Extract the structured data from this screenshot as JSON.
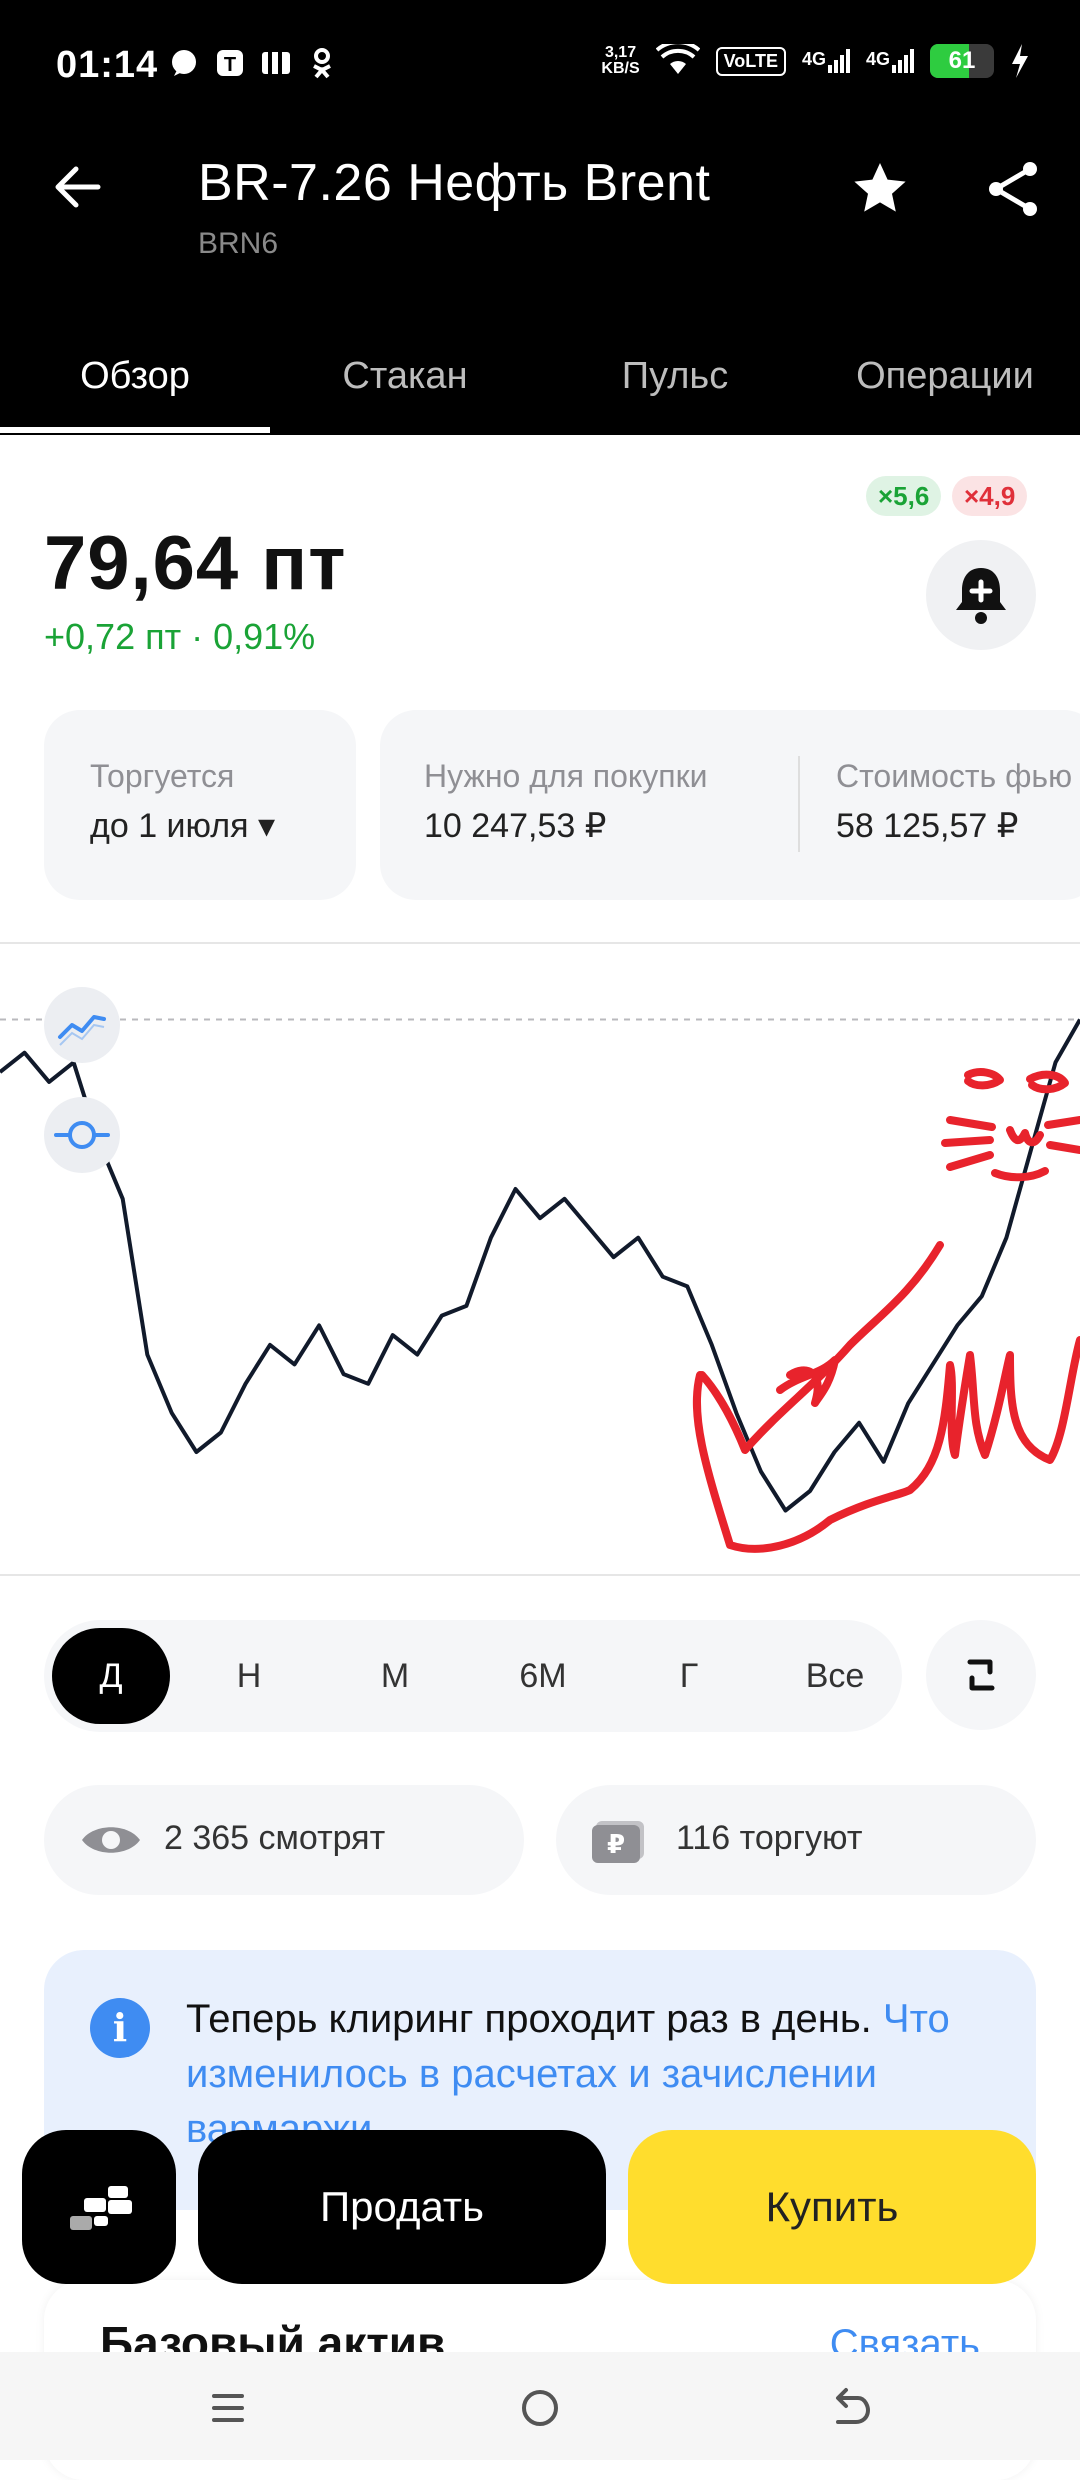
{
  "status_bar": {
    "time": "01:14",
    "net_speed_top": "3,17",
    "net_speed_bottom": "KB/S",
    "volte": "VoLTE",
    "net1": "4G",
    "net2": "4G",
    "battery": "61",
    "battery_level": 0.61
  },
  "header": {
    "title": "BR-7.26 Нефть Brent",
    "ticker": "BRN6"
  },
  "tabs": [
    "Обзор",
    "Стакан",
    "Пульс",
    "Операции"
  ],
  "active_tab": "Обзор",
  "leverage": {
    "long": "×5,6",
    "short": "×4,9"
  },
  "price": {
    "value": "79,64 пт",
    "change": "+0,72 пт · 0,91%"
  },
  "info_cards": [
    {
      "label": "Торгуется",
      "value": "до 1 июля ▾"
    },
    {
      "label": "Нужно для покупки",
      "value": "10 247,53 ₽"
    },
    {
      "label": "Стоимость фью",
      "value": "58 125,57 ₽"
    }
  ],
  "chart_data": {
    "type": "line",
    "series": [
      {
        "values": [
          79.1,
          79.3,
          79.0,
          79.2,
          78.4,
          77.8,
          76.2,
          75.6,
          75.2,
          75.4,
          75.9,
          76.3,
          76.1,
          76.5,
          76.0,
          75.9,
          76.4,
          76.2,
          76.6,
          76.7,
          77.4,
          77.9,
          77.6,
          77.8,
          77.5,
          77.2,
          77.4,
          77.0,
          76.9,
          76.3,
          75.6,
          75.0,
          74.6,
          74.8,
          75.2,
          75.5,
          75.1,
          75.7,
          76.1,
          76.5,
          76.8,
          77.4,
          78.3,
          79.2,
          79.64
        ]
      }
    ],
    "reference_line": 79.64,
    "grid": false
  },
  "periods": [
    "Д",
    "Н",
    "М",
    "6М",
    "Г",
    "Все"
  ],
  "active_period": "Д",
  "stats": {
    "watching": "2 365 смотрят",
    "trading": "116 торгуют"
  },
  "notice": {
    "text": "Теперь клиринг проходит раз в день.",
    "link": "Что изменилось в расчетах и зачислении вармаржи"
  },
  "actions": {
    "sell": "Продать",
    "buy": "Купить"
  },
  "base_asset": {
    "title": "Базовый актив",
    "link": "Связать"
  },
  "colors": {
    "accent": "#ffdd2d",
    "positive": "#1aa336",
    "negative": "#e0303a",
    "link": "#3f8cf2"
  }
}
